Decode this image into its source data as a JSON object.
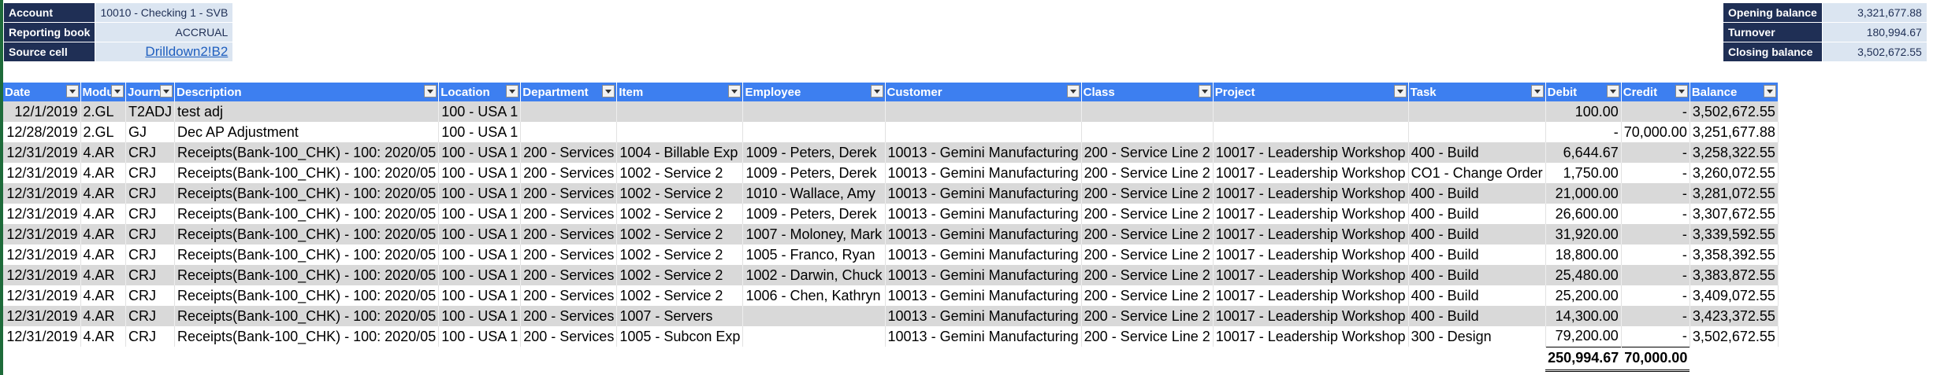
{
  "info_left": {
    "account_label": "Account",
    "account_value": "10010 - Checking 1 - SVB",
    "book_label": "Reporting book",
    "book_value": "ACCRUAL",
    "source_label": "Source cell",
    "source_value": "Drilldown2!B2"
  },
  "info_right": {
    "opening_label": "Opening balance",
    "opening_value": "3,321,677.88",
    "turnover_label": "Turnover",
    "turnover_value": "180,994.67",
    "closing_label": "Closing balance",
    "closing_value": "3,502,672.55"
  },
  "columns": [
    "Date",
    "Module",
    "Journal",
    "Description",
    "Location",
    "Department",
    "Item",
    "Employee",
    "Customer",
    "Class",
    "Project",
    "Task",
    "Debit",
    "Credit",
    "Balance"
  ],
  "rows": [
    [
      "12/1/2019",
      "2.GL",
      "T2ADJ",
      "test adj",
      "100 - USA 1",
      "",
      "",
      "",
      "",
      "",
      "",
      "",
      "100.00",
      "-",
      "3,502,672.55"
    ],
    [
      "12/28/2019",
      "2.GL",
      "GJ",
      "Dec AP Adjustment",
      "100 - USA 1",
      "",
      "",
      "",
      "",
      "",
      "",
      "",
      "-",
      "70,000.00",
      "3,251,677.88"
    ],
    [
      "12/31/2019",
      "4.AR",
      "CRJ",
      "Receipts(Bank-100_CHK) - 100: 2020/05",
      "100 - USA 1",
      "200 - Services",
      "1004 - Billable Exp",
      "1009 - Peters, Derek",
      "10013 - Gemini Manufacturing",
      "200 - Service Line 2",
      "10017 - Leadership Workshop",
      "400 - Build",
      "6,644.67",
      "-",
      "3,258,322.55"
    ],
    [
      "12/31/2019",
      "4.AR",
      "CRJ",
      "Receipts(Bank-100_CHK) - 100: 2020/05",
      "100 - USA 1",
      "200 - Services",
      "1002 - Service 2",
      "1009 - Peters, Derek",
      "10013 - Gemini Manufacturing",
      "200 - Service Line 2",
      "10017 - Leadership Workshop",
      "CO1 - Change Order",
      "1,750.00",
      "-",
      "3,260,072.55"
    ],
    [
      "12/31/2019",
      "4.AR",
      "CRJ",
      "Receipts(Bank-100_CHK) - 100: 2020/05",
      "100 - USA 1",
      "200 - Services",
      "1002 - Service 2",
      "1010 - Wallace, Amy",
      "10013 - Gemini Manufacturing",
      "200 - Service Line 2",
      "10017 - Leadership Workshop",
      "400 - Build",
      "21,000.00",
      "-",
      "3,281,072.55"
    ],
    [
      "12/31/2019",
      "4.AR",
      "CRJ",
      "Receipts(Bank-100_CHK) - 100: 2020/05",
      "100 - USA 1",
      "200 - Services",
      "1002 - Service 2",
      "1009 - Peters, Derek",
      "10013 - Gemini Manufacturing",
      "200 - Service Line 2",
      "10017 - Leadership Workshop",
      "400 - Build",
      "26,600.00",
      "-",
      "3,307,672.55"
    ],
    [
      "12/31/2019",
      "4.AR",
      "CRJ",
      "Receipts(Bank-100_CHK) - 100: 2020/05",
      "100 - USA 1",
      "200 - Services",
      "1002 - Service 2",
      "1007 - Moloney, Mark",
      "10013 - Gemini Manufacturing",
      "200 - Service Line 2",
      "10017 - Leadership Workshop",
      "400 - Build",
      "31,920.00",
      "-",
      "3,339,592.55"
    ],
    [
      "12/31/2019",
      "4.AR",
      "CRJ",
      "Receipts(Bank-100_CHK) - 100: 2020/05",
      "100 - USA 1",
      "200 - Services",
      "1002 - Service 2",
      "1005 - Franco, Ryan",
      "10013 - Gemini Manufacturing",
      "200 - Service Line 2",
      "10017 - Leadership Workshop",
      "400 - Build",
      "18,800.00",
      "-",
      "3,358,392.55"
    ],
    [
      "12/31/2019",
      "4.AR",
      "CRJ",
      "Receipts(Bank-100_CHK) - 100: 2020/05",
      "100 - USA 1",
      "200 - Services",
      "1002 - Service 2",
      "1002 - Darwin, Chuck",
      "10013 - Gemini Manufacturing",
      "200 - Service Line 2",
      "10017 - Leadership Workshop",
      "400 - Build",
      "25,480.00",
      "-",
      "3,383,872.55"
    ],
    [
      "12/31/2019",
      "4.AR",
      "CRJ",
      "Receipts(Bank-100_CHK) - 100: 2020/05",
      "100 - USA 1",
      "200 - Services",
      "1002 - Service 2",
      "1006 - Chen, Kathryn",
      "10013 - Gemini Manufacturing",
      "200 - Service Line 2",
      "10017 - Leadership Workshop",
      "400 - Build",
      "25,200.00",
      "-",
      "3,409,072.55"
    ],
    [
      "12/31/2019",
      "4.AR",
      "CRJ",
      "Receipts(Bank-100_CHK) - 100: 2020/05",
      "100 - USA 1",
      "200 - Services",
      "1007 - Servers",
      "",
      "10013 - Gemini Manufacturing",
      "200 - Service Line 2",
      "10017 - Leadership Workshop",
      "400 - Build",
      "14,300.00",
      "-",
      "3,423,372.55"
    ],
    [
      "12/31/2019",
      "4.AR",
      "CRJ",
      "Receipts(Bank-100_CHK) - 100: 2020/05",
      "100 - USA 1",
      "200 - Services",
      "1005 - Subcon Exp",
      "",
      "10013 - Gemini Manufacturing",
      "200 - Service Line 2",
      "10017 - Leadership Workshop",
      "300 - Design",
      "79,200.00",
      "-",
      "3,502,672.55"
    ]
  ],
  "totals": {
    "debit": "250,994.67",
    "credit": "70,000.00"
  }
}
